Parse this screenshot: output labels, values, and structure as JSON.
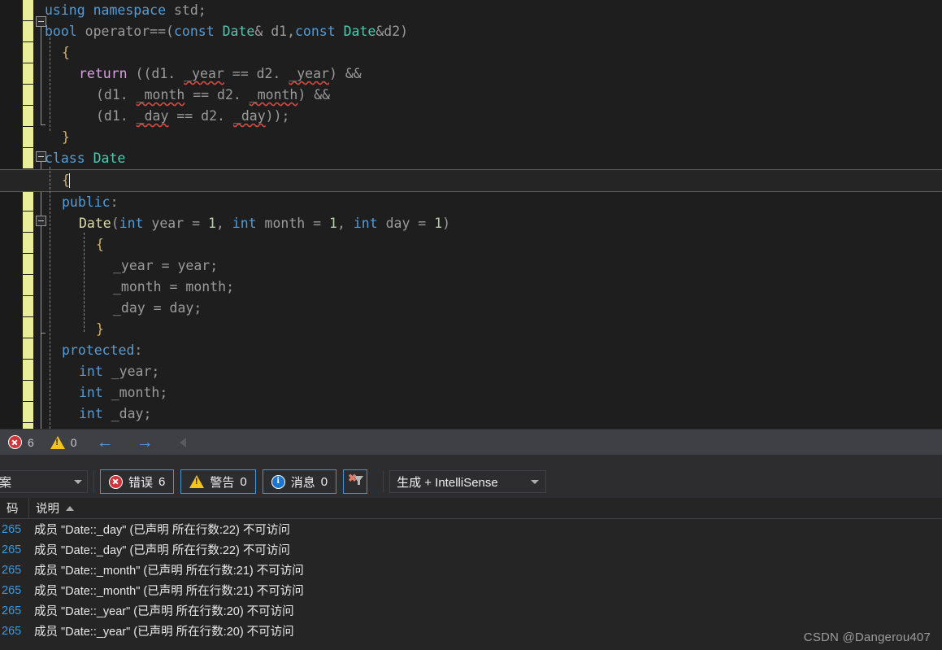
{
  "editor": {
    "language": "cpp",
    "code_lines": [
      {
        "indent": 0,
        "tokens": [
          {
            "t": "using",
            "c": "kw"
          },
          {
            "t": " ",
            "c": "plain"
          },
          {
            "t": "namespace",
            "c": "kw"
          },
          {
            "t": " std;",
            "c": "plain"
          }
        ]
      },
      {
        "indent": 0,
        "tokens": [
          {
            "t": "bool",
            "c": "kw"
          },
          {
            "t": " operator==(",
            "c": "plain"
          },
          {
            "t": "const",
            "c": "kw"
          },
          {
            "t": " ",
            "c": "plain"
          },
          {
            "t": "Date",
            "c": "type"
          },
          {
            "t": "& d1,",
            "c": "plain"
          },
          {
            "t": "const",
            "c": "kw"
          },
          {
            "t": " ",
            "c": "plain"
          },
          {
            "t": "Date",
            "c": "type"
          },
          {
            "t": "&d2)",
            "c": "plain"
          }
        ]
      },
      {
        "indent": 1,
        "tokens": [
          {
            "t": "{",
            "c": "brace"
          }
        ]
      },
      {
        "indent": 2,
        "tokens": [
          {
            "t": "return",
            "c": "ctl"
          },
          {
            "t": " ((d1. ",
            "c": "plain"
          },
          {
            "t": "_year",
            "c": "err"
          },
          {
            "t": " == d2. ",
            "c": "plain"
          },
          {
            "t": "_year",
            "c": "err"
          },
          {
            "t": ") &&",
            "c": "plain"
          }
        ]
      },
      {
        "indent": 3,
        "tokens": [
          {
            "t": "(d1. ",
            "c": "plain"
          },
          {
            "t": "_month",
            "c": "err"
          },
          {
            "t": " == d2. ",
            "c": "plain"
          },
          {
            "t": "_month",
            "c": "err"
          },
          {
            "t": ") &&",
            "c": "plain"
          }
        ]
      },
      {
        "indent": 3,
        "tokens": [
          {
            "t": "(d1. ",
            "c": "plain"
          },
          {
            "t": "_day",
            "c": "err"
          },
          {
            "t": " == d2. ",
            "c": "plain"
          },
          {
            "t": "_day",
            "c": "err"
          },
          {
            "t": "));",
            "c": "plain"
          }
        ]
      },
      {
        "indent": 1,
        "tokens": [
          {
            "t": "}",
            "c": "brace"
          }
        ]
      },
      {
        "indent": 0,
        "tokens": [
          {
            "t": "class",
            "c": "kw"
          },
          {
            "t": " ",
            "c": "plain"
          },
          {
            "t": "Date",
            "c": "type"
          }
        ]
      },
      {
        "indent": 1,
        "current": true,
        "tokens": [
          {
            "t": "{",
            "c": "brace"
          }
        ]
      },
      {
        "indent": 1,
        "tokens": [
          {
            "t": "public",
            "c": "kw"
          },
          {
            "t": ":",
            "c": "plain"
          }
        ]
      },
      {
        "indent": 2,
        "tokens": [
          {
            "t": "Date",
            "c": "fn"
          },
          {
            "t": "(",
            "c": "plain"
          },
          {
            "t": "int",
            "c": "kw"
          },
          {
            "t": " year = ",
            "c": "plain"
          },
          {
            "t": "1",
            "c": "num"
          },
          {
            "t": ", ",
            "c": "plain"
          },
          {
            "t": "int",
            "c": "kw"
          },
          {
            "t": " month = ",
            "c": "plain"
          },
          {
            "t": "1",
            "c": "num"
          },
          {
            "t": ", ",
            "c": "plain"
          },
          {
            "t": "int",
            "c": "kw"
          },
          {
            "t": " day = ",
            "c": "plain"
          },
          {
            "t": "1",
            "c": "num"
          },
          {
            "t": ")",
            "c": "plain"
          }
        ]
      },
      {
        "indent": 3,
        "tokens": [
          {
            "t": "{",
            "c": "brace"
          }
        ]
      },
      {
        "indent": 4,
        "tokens": [
          {
            "t": "_year = year;",
            "c": "plain"
          }
        ]
      },
      {
        "indent": 4,
        "tokens": [
          {
            "t": "_month = month;",
            "c": "plain"
          }
        ]
      },
      {
        "indent": 4,
        "tokens": [
          {
            "t": "_day = day;",
            "c": "plain"
          }
        ]
      },
      {
        "indent": 3,
        "tokens": [
          {
            "t": "}",
            "c": "brace"
          }
        ]
      },
      {
        "indent": 1,
        "tokens": [
          {
            "t": "protected",
            "c": "kw"
          },
          {
            "t": ":",
            "c": "plain"
          }
        ]
      },
      {
        "indent": 2,
        "tokens": [
          {
            "t": "int",
            "c": "kw"
          },
          {
            "t": " _year;",
            "c": "plain"
          }
        ]
      },
      {
        "indent": 2,
        "tokens": [
          {
            "t": "int",
            "c": "kw"
          },
          {
            "t": " _month;",
            "c": "plain"
          }
        ]
      },
      {
        "indent": 2,
        "tokens": [
          {
            "t": "int",
            "c": "kw"
          },
          {
            "t": " _day;",
            "c": "plain"
          }
        ]
      }
    ]
  },
  "editor_status": {
    "error_icon": "error-circle-icon",
    "error_count": "6",
    "warning_icon": "warning-triangle-icon",
    "warning_count": "0",
    "prev_icon": "arrow-left-icon",
    "prev_glyph": "←",
    "next_icon": "arrow-right-icon",
    "next_glyph": "→",
    "collapse_icon": "triangle-left-icon"
  },
  "error_list": {
    "scope_combo": {
      "value": "案",
      "caret_icon": "chevron-down-icon"
    },
    "errors_chip": {
      "icon": "error-circle-icon",
      "label": "错误",
      "count": "6"
    },
    "warnings_chip": {
      "icon": "warning-triangle-icon",
      "label": "警告",
      "count": "0"
    },
    "messages_chip": {
      "icon": "info-circle-icon",
      "label": "消息",
      "count": "0"
    },
    "clear_filter_button": {
      "icon": "clear-filter-icon",
      "x_glyph": "✖"
    },
    "build_combo": {
      "value": "生成 + IntelliSense",
      "caret_icon": "chevron-down-icon"
    },
    "columns": [
      {
        "key": "code",
        "label": "码"
      },
      {
        "key": "description",
        "label": "说明",
        "sort_icon": "sort-ascending-icon",
        "sorted": true
      }
    ],
    "rows": [
      {
        "code": "265",
        "description": "成员 \"Date::_day\" (已声明 所在行数:22) 不可访问"
      },
      {
        "code": "265",
        "description": "成员 \"Date::_day\" (已声明 所在行数:22) 不可访问"
      },
      {
        "code": "265",
        "description": "成员 \"Date::_month\" (已声明 所在行数:21) 不可访问"
      },
      {
        "code": "265",
        "description": "成员 \"Date::_month\" (已声明 所在行数:21) 不可访问"
      },
      {
        "code": "265",
        "description": "成员 \"Date::_year\" (已声明 所在行数:20) 不可访问"
      },
      {
        "code": "265",
        "description": "成员 \"Date::_year\" (已声明 所在行数:20) 不可访问"
      }
    ]
  },
  "watermark": {
    "text": "CSDN @Dangerou407"
  },
  "colors": {
    "editor_background": "#1e1e1e",
    "change_bar": "#eaee9a",
    "keyword": "#559cd6",
    "type": "#4ec9b0",
    "function": "#dcdcaa",
    "control": "#d8a0df",
    "number": "#b5cea8",
    "plain_text": "#9b9b9b",
    "squiggle": "#d14b43",
    "accent_border": "#3a96dd",
    "error_red": "#d13438",
    "warning_yellow": "#f3c41b",
    "info_blue": "#1976d2",
    "code_link": "#3a9ae0"
  }
}
